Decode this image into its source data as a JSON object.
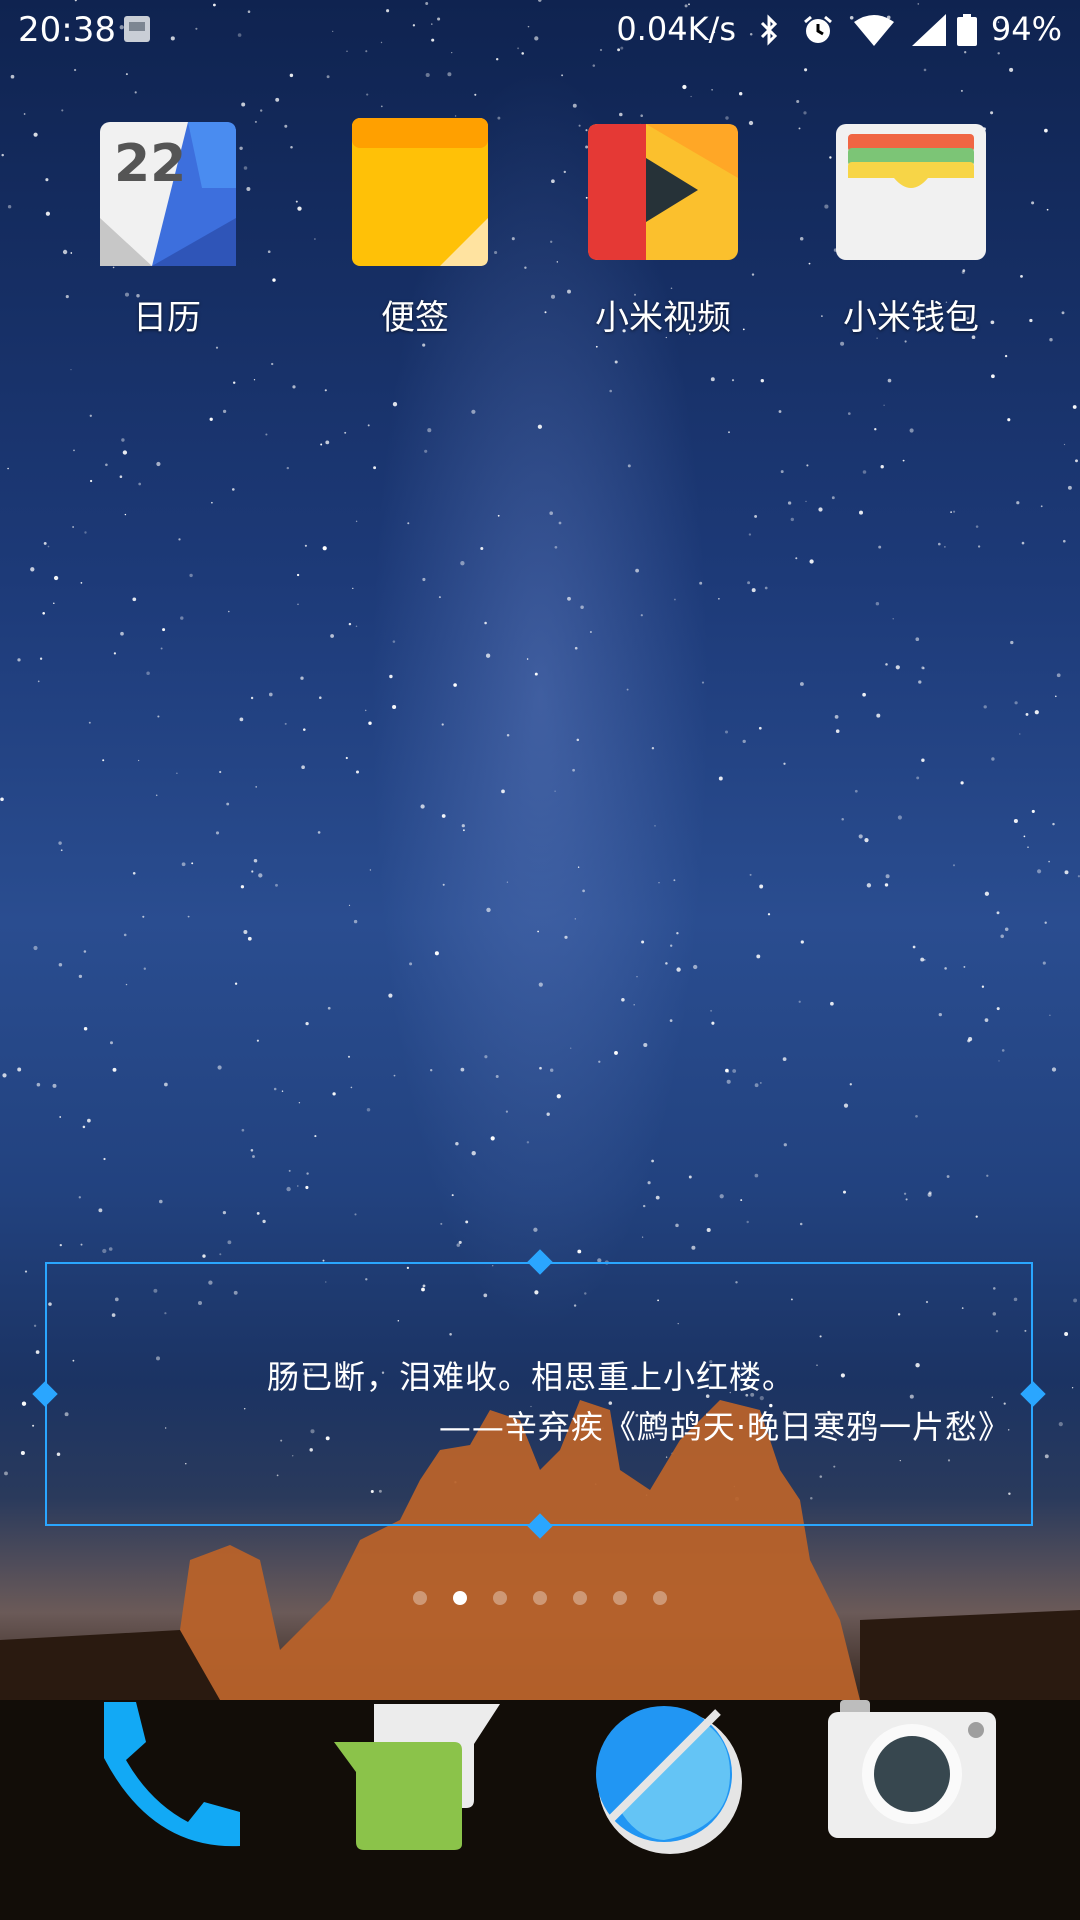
{
  "status_bar": {
    "time": "20:38",
    "network_speed": "0.04K/s",
    "battery": "94%",
    "icons": [
      "notification-icon",
      "bluetooth-icon",
      "alarm-icon",
      "wifi-icon",
      "cellular-signal-icon",
      "battery-icon"
    ]
  },
  "apps": [
    {
      "label": "日历",
      "icon": "calendar-icon",
      "date": "22"
    },
    {
      "label": "便签",
      "icon": "notes-icon"
    },
    {
      "label": "小米视频",
      "icon": "video-icon"
    },
    {
      "label": "小米钱包",
      "icon": "wallet-icon"
    }
  ],
  "widget": {
    "line1": "肠已断，泪难收。相思重上小红楼。",
    "line2": "——辛弃疾《鹧鸪天·晚日寒鸦一片愁》"
  },
  "pages": {
    "count": 7,
    "current": 2
  },
  "dock": [
    {
      "icon": "phone-icon"
    },
    {
      "icon": "messages-icon"
    },
    {
      "icon": "browser-icon"
    },
    {
      "icon": "camera-icon"
    }
  ],
  "colors": {
    "accent": "#2aa6ff",
    "phone": "#12a9f5",
    "messages": "#8bc34a",
    "browser": "#2196f3"
  }
}
